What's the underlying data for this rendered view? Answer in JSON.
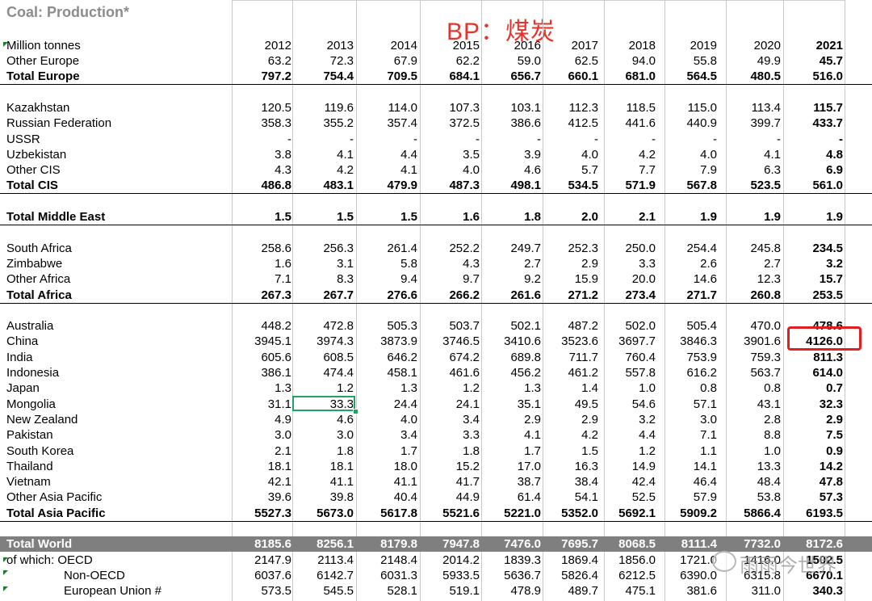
{
  "sheet": {
    "title": "Coal: Production*",
    "annotation": "BP：煤炭",
    "unit_label": "Million tonnes",
    "years": [
      "2012",
      "2013",
      "2014",
      "2015",
      "2016",
      "2017",
      "2018",
      "2019",
      "2020",
      "2021"
    ]
  },
  "rows": [
    {
      "label": "Other Europe",
      "values": [
        "63.2",
        "72.3",
        "67.9",
        "62.2",
        "59.0",
        "62.5",
        "94.0",
        "55.8",
        "49.9",
        "45.7"
      ]
    },
    {
      "label": "Total Europe",
      "bold": true,
      "total": true,
      "values": [
        "797.2",
        "754.4",
        "709.5",
        "684.1",
        "656.7",
        "660.1",
        "681.0",
        "564.5",
        "480.5",
        "516.0"
      ]
    },
    {
      "label": "",
      "blank": true
    },
    {
      "label": "Kazakhstan",
      "values": [
        "120.5",
        "119.6",
        "114.0",
        "107.3",
        "103.1",
        "112.3",
        "118.5",
        "115.0",
        "113.4",
        "115.7"
      ]
    },
    {
      "label": "Russian Federation",
      "values": [
        "358.3",
        "355.2",
        "357.4",
        "372.5",
        "386.6",
        "412.5",
        "441.6",
        "440.9",
        "399.7",
        "433.7"
      ]
    },
    {
      "label": "USSR",
      "values": [
        "-",
        "-",
        "-",
        "-",
        "-",
        "-",
        "-",
        "-",
        "-",
        "-"
      ]
    },
    {
      "label": "Uzbekistan",
      "values": [
        "3.8",
        "4.1",
        "4.4",
        "3.5",
        "3.9",
        "4.0",
        "4.2",
        "4.0",
        "4.1",
        "4.8"
      ]
    },
    {
      "label": "Other CIS",
      "values": [
        "4.3",
        "4.2",
        "4.1",
        "4.0",
        "4.6",
        "5.7",
        "7.7",
        "7.9",
        "6.3",
        "6.9"
      ]
    },
    {
      "label": "Total CIS",
      "bold": true,
      "total": true,
      "values": [
        "486.8",
        "483.1",
        "479.9",
        "487.3",
        "498.1",
        "534.5",
        "571.9",
        "567.8",
        "523.5",
        "561.0"
      ]
    },
    {
      "label": "",
      "blank": true
    },
    {
      "label": "Total Middle East",
      "bold": true,
      "total": true,
      "values": [
        "1.5",
        "1.5",
        "1.5",
        "1.6",
        "1.8",
        "2.0",
        "2.1",
        "1.9",
        "1.9",
        "1.9"
      ]
    },
    {
      "label": "",
      "blank": true
    },
    {
      "label": "South Africa",
      "values": [
        "258.6",
        "256.3",
        "261.4",
        "252.2",
        "249.7",
        "252.3",
        "250.0",
        "254.4",
        "245.8",
        "234.5"
      ]
    },
    {
      "label": "Zimbabwe",
      "values": [
        "1.6",
        "3.1",
        "5.8",
        "4.3",
        "2.7",
        "2.9",
        "3.3",
        "2.6",
        "2.7",
        "3.2"
      ]
    },
    {
      "label": "Other Africa",
      "values": [
        "7.1",
        "8.3",
        "9.4",
        "9.7",
        "9.2",
        "15.9",
        "20.0",
        "14.6",
        "12.3",
        "15.7"
      ]
    },
    {
      "label": "Total Africa",
      "bold": true,
      "total": true,
      "values": [
        "267.3",
        "267.7",
        "276.6",
        "266.2",
        "261.6",
        "271.2",
        "273.4",
        "271.7",
        "260.8",
        "253.5"
      ]
    },
    {
      "label": "",
      "blank": true
    },
    {
      "label": "Australia",
      "values": [
        "448.2",
        "472.8",
        "505.3",
        "503.7",
        "502.1",
        "487.2",
        "502.0",
        "505.4",
        "470.0",
        "478.6"
      ]
    },
    {
      "label": "China",
      "values": [
        "3945.1",
        "3974.3",
        "3873.9",
        "3746.5",
        "3410.6",
        "3523.6",
        "3697.7",
        "3846.3",
        "3901.6",
        "4126.0"
      ]
    },
    {
      "label": "India",
      "values": [
        "605.6",
        "608.5",
        "646.2",
        "674.2",
        "689.8",
        "711.7",
        "760.4",
        "753.9",
        "759.3",
        "811.3"
      ]
    },
    {
      "label": "Indonesia",
      "values": [
        "386.1",
        "474.4",
        "458.1",
        "461.6",
        "456.2",
        "461.2",
        "557.8",
        "616.2",
        "563.7",
        "614.0"
      ]
    },
    {
      "label": "Japan",
      "values": [
        "1.3",
        "1.2",
        "1.3",
        "1.2",
        "1.3",
        "1.4",
        "1.0",
        "0.8",
        "0.8",
        "0.7"
      ]
    },
    {
      "label": "Mongolia",
      "values": [
        "31.1",
        "33.3",
        "24.4",
        "24.1",
        "35.1",
        "49.5",
        "54.6",
        "57.1",
        "43.1",
        "32.3"
      ]
    },
    {
      "label": "New Zealand",
      "values": [
        "4.9",
        "4.6",
        "4.0",
        "3.4",
        "2.9",
        "2.9",
        "3.2",
        "3.0",
        "2.8",
        "2.9"
      ]
    },
    {
      "label": "Pakistan",
      "values": [
        "3.0",
        "3.0",
        "3.4",
        "3.3",
        "4.1",
        "4.2",
        "4.4",
        "7.1",
        "8.8",
        "7.5"
      ]
    },
    {
      "label": "South Korea",
      "values": [
        "2.1",
        "1.8",
        "1.7",
        "1.8",
        "1.7",
        "1.5",
        "1.2",
        "1.1",
        "1.0",
        "0.9"
      ]
    },
    {
      "label": "Thailand",
      "values": [
        "18.1",
        "18.1",
        "18.0",
        "15.2",
        "17.0",
        "16.3",
        "14.9",
        "14.1",
        "13.3",
        "14.2"
      ]
    },
    {
      "label": "Vietnam",
      "values": [
        "42.1",
        "41.1",
        "41.1",
        "41.7",
        "38.7",
        "38.4",
        "42.4",
        "46.4",
        "48.4",
        "47.8"
      ]
    },
    {
      "label": "Other Asia Pacific",
      "values": [
        "39.6",
        "39.8",
        "40.4",
        "44.9",
        "61.4",
        "54.1",
        "52.5",
        "57.9",
        "53.8",
        "57.3"
      ]
    },
    {
      "label": "Total Asia Pacific",
      "bold": true,
      "total": true,
      "values": [
        "5527.3",
        "5673.0",
        "5617.8",
        "5521.6",
        "5221.0",
        "5352.0",
        "5692.1",
        "5909.2",
        "5866.4",
        "6193.5"
      ]
    },
    {
      "label": "",
      "blank": true
    },
    {
      "label": "Total World",
      "dark": true,
      "values": [
        "8185.6",
        "8256.1",
        "8179.8",
        "7947.8",
        "7476.0",
        "7695.7",
        "8068.5",
        "8111.4",
        "7732.0",
        "8172.6"
      ]
    },
    {
      "label": "of which: OECD",
      "values": [
        "2147.9",
        "2113.4",
        "2148.4",
        "2014.2",
        "1839.3",
        "1869.4",
        "1856.0",
        "1721.0",
        "1416.0",
        "1502.5"
      ]
    },
    {
      "label": "Non-OECD",
      "indent": true,
      "values": [
        "6037.6",
        "6142.7",
        "6031.3",
        "5933.5",
        "5636.7",
        "5826.4",
        "6212.5",
        "6390.0",
        "6315.8",
        "6670.1"
      ]
    },
    {
      "label": "European Union #",
      "indent": true,
      "values": [
        "573.5",
        "545.5",
        "528.1",
        "519.1",
        "478.9",
        "489.7",
        "475.1",
        "381.6",
        "311.0",
        "340.3"
      ]
    }
  ],
  "watermark": {
    "text": "雨雨今世界"
  }
}
